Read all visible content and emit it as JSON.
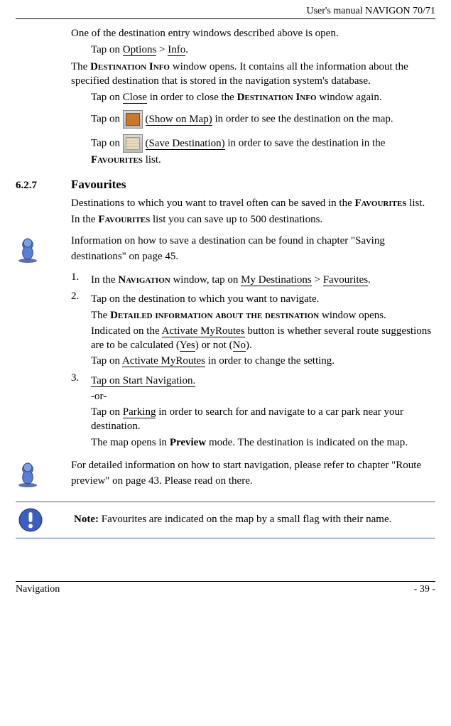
{
  "header": {
    "title": "User's manual NAVIGON 70/71"
  },
  "body": {
    "p1": "One of the destination entry windows described above is open.",
    "p2_pre": "Tap on ",
    "p2_link1": "Options",
    "p2_mid": " > ",
    "p2_link2": "Info",
    "p2_post": ".",
    "p3_pre": "The ",
    "p3_win": "Destination Info",
    "p3_post": " window opens. It contains all the information about the specified destination that is stored in the navigation system's database.",
    "p4_pre": "Tap on ",
    "p4_link": "Close",
    "p4_mid": " in order to close the ",
    "p4_win": "Destination Info",
    "p4_post": " window again.",
    "p5_pre": "Tap on ",
    "p5_link": "(Show on Map)",
    "p5_post": " in order to see the destination on the map.",
    "p6_pre": "Tap on ",
    "p6_link": "(Save Destination)",
    "p6_mid": " in order to save the destination in the ",
    "p6_list": "Favourites",
    "p6_post": " list."
  },
  "section": {
    "num": "6.2.7",
    "title": "Favourites",
    "p1_pre": "Destinations to which you want to travel often can be saved in the ",
    "p1_list": "Favourites",
    "p1_post": " list.",
    "p2_pre": "In the ",
    "p2_list": "Favourites",
    "p2_post": " list you can save up to 500 destinations."
  },
  "info1": {
    "text": "Information on how to save a destination can be found in chapter \"Saving destinations\" on page 45."
  },
  "steps": {
    "s1_pre": "In the ",
    "s1_win": "Navigation",
    "s1_mid": " window, tap on ",
    "s1_link1": "My Destinations",
    "s1_sep": " > ",
    "s1_link2": "Favourites",
    "s1_post": ".",
    "s2a": "Tap on the destination to which you want to navigate.",
    "s2b_pre": "The ",
    "s2b_win": "Detailed information about the destination",
    "s2b_post": " window opens.",
    "s2c_pre": "Indicated on the ",
    "s2c_link": "Activate MyRoutes",
    "s2c_mid": " button is whether several route suggestions are to be calculated (",
    "s2c_yes": "Yes",
    "s2c_mid2": ") or not (",
    "s2c_no": "No",
    "s2c_post": ").",
    "s2d_pre": "Tap on ",
    "s2d_link": "Activate MyRoutes",
    "s2d_post": " in order to change the setting.",
    "s3a": "Tap on Start Navigation.",
    "s3b": "-or-",
    "s3c_pre": "Tap on ",
    "s3c_link": "Parking",
    "s3c_post": " in order to search for and navigate to a car park near your destination.",
    "s3d_pre": "The map opens in ",
    "s3d_bold": "Preview",
    "s3d_post": " mode. The destination is indicated on the map."
  },
  "info2": {
    "text": "For detailed information on how to start navigation, please refer to chapter \"Route preview\" on page 43. Please read on there."
  },
  "note": {
    "label": "Note:",
    "text": " Favourites are indicated on the map by a small flag with their name."
  },
  "footer": {
    "left": "Navigation",
    "right": "- 39 -"
  }
}
